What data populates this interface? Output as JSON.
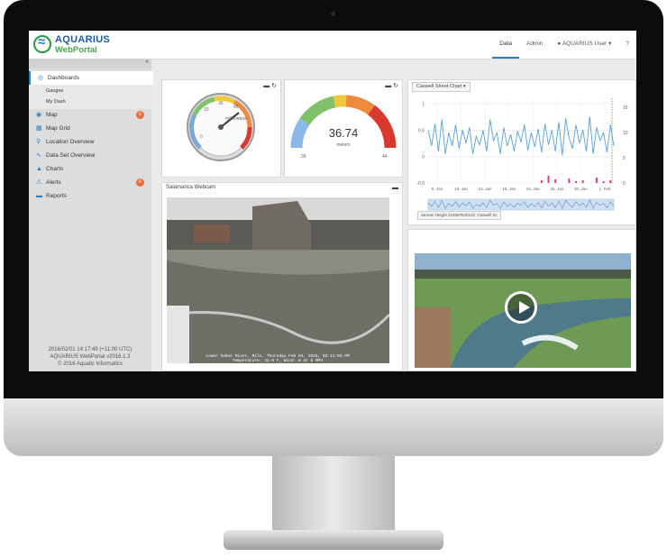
{
  "logo": {
    "line1": "AQUARIUS",
    "line2": "WebPortal"
  },
  "topnav": {
    "data": "Data",
    "admin": "Admin",
    "user": "AQUARIUS User ▾",
    "help": "?"
  },
  "sidebar": {
    "collapse_icon": "«",
    "items": [
      {
        "label": "Dashboards",
        "icon": "dashboard-icon"
      },
      {
        "label": "Gauges"
      },
      {
        "label": "My Dash"
      },
      {
        "label": "Map",
        "icon": "globe-icon",
        "badge": "6"
      },
      {
        "label": "Map Grid",
        "icon": "grid-icon"
      },
      {
        "label": "Location Overview",
        "icon": "marker-icon"
      },
      {
        "label": "Data Set Overview",
        "icon": "chart-line-icon"
      },
      {
        "label": "Charts",
        "icon": "chart-area-icon"
      },
      {
        "label": "Alerts",
        "icon": "warning-icon",
        "badge": "6"
      },
      {
        "label": "Reports",
        "icon": "book-icon"
      }
    ],
    "footer": [
      "2016/02/01 14:17:49 (+11:00 UTC)",
      "AQUARIUS WebPortal v2016.1.3",
      "© 2016 Aquatic Informatics"
    ]
  },
  "gauge1": {
    "unit": "millimeters",
    "ticks": [
      "0",
      "15",
      "30",
      "45"
    ]
  },
  "gauge2": {
    "value": "36.74",
    "unit": "meters",
    "min": "36",
    "max": "44"
  },
  "chart_panel": {
    "dropdown": "Caswell Street Chart ▾",
    "legend": "Stream Height 21555#540132, Caswell St."
  },
  "chart_data": {
    "type": "line",
    "xticks": [
      "6. Jan",
      "10. Jan",
      "14. Jan",
      "18. Jan",
      "22. Jan",
      "26. Jan",
      "30. Jan",
      "1. Feb"
    ],
    "yticks_left": [
      "1",
      "0.5",
      "0",
      "-0.5"
    ],
    "yticks_right": [
      "15",
      "10",
      "5",
      "0"
    ],
    "ylim": [
      -0.5,
      1.1
    ],
    "series": [
      {
        "values": [
          0.5,
          0.2,
          0.62,
          0.1,
          0.7,
          0.05,
          0.45,
          0.2,
          0.6,
          0.15,
          0.5,
          0.25,
          0.55,
          0.05,
          0.38,
          0.22,
          0.5,
          0.1,
          0.7,
          0.3,
          0.45,
          0.05,
          0.55,
          0.2,
          0.42,
          0.1,
          0.48,
          0.28,
          0.6,
          0.12,
          0.45,
          0.18,
          0.52,
          0.08,
          0.62,
          0.22,
          0.5,
          0.1,
          0.65,
          0.02,
          0.72,
          0.35,
          0.15,
          0.6,
          0.25,
          0.5,
          0.1,
          0.75,
          0.05,
          0.55,
          0.3,
          0.45,
          0.08,
          0.6,
          0.2
        ]
      },
      {
        "bars": [
          0,
          0,
          0,
          0,
          0,
          0,
          0,
          0,
          0,
          0,
          0,
          0,
          0,
          0,
          0,
          0,
          0,
          0,
          0,
          0,
          0,
          0,
          0,
          0,
          0,
          0,
          0,
          0,
          0,
          0,
          0,
          0,
          0,
          0.3,
          0,
          0.8,
          0,
          0.4,
          0,
          0,
          0,
          0.5,
          0,
          0.2,
          0,
          0.3,
          0,
          0,
          0,
          0.6,
          0,
          0.2,
          0,
          0.3,
          0
        ]
      }
    ]
  },
  "webcam_panel": {
    "title": "Salamanca Webcam",
    "caption1": "Lower Sebec River, Milo, Thursday Feb 04, 2016, 03:11:00 PM",
    "caption2": "Temperature: 32.0 F, Wind: W at 8 MPH"
  },
  "colors": {
    "accent": "#2a7fc1",
    "brand_green": "#4aa34b",
    "badge": "#e96e3c"
  }
}
